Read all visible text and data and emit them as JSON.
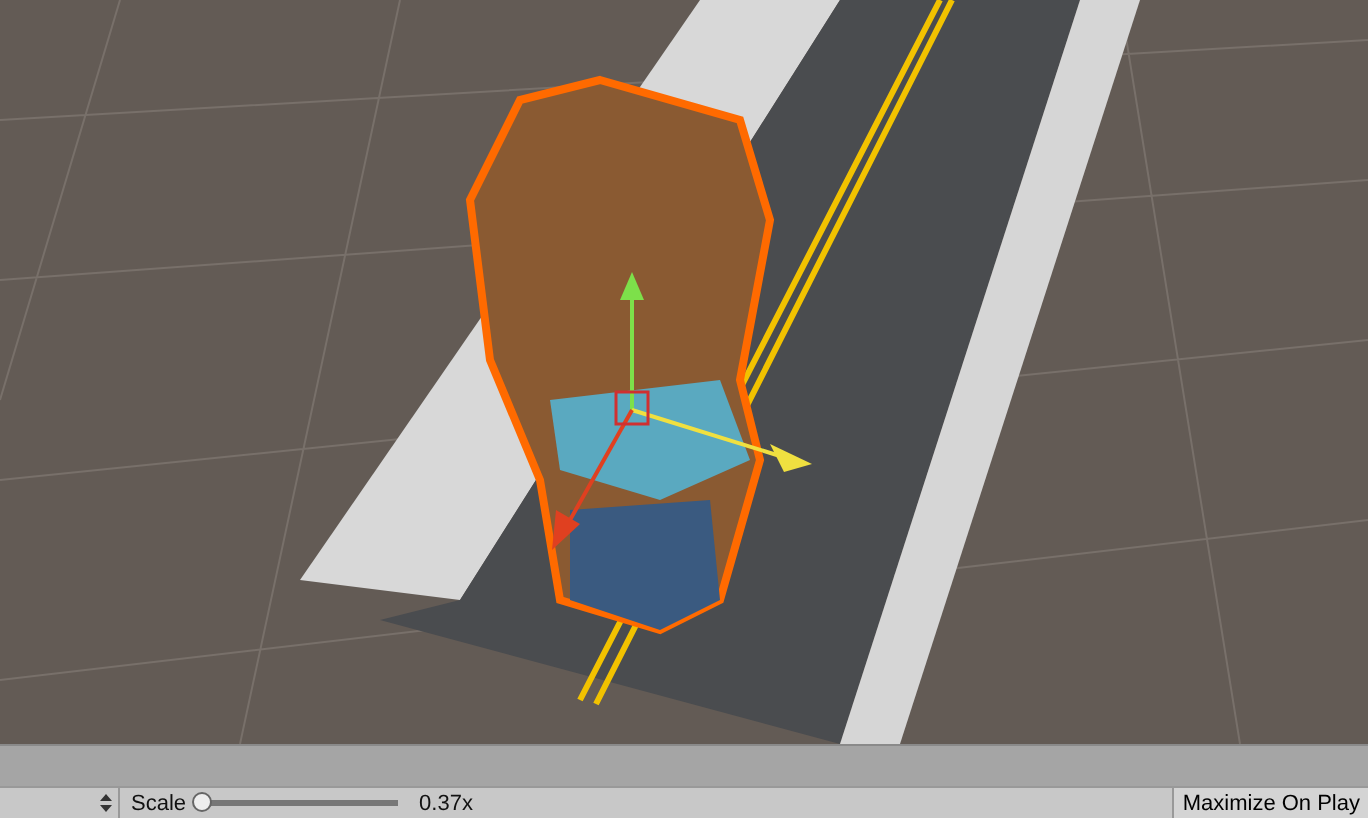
{
  "scene_view": {
    "kind": "scene"
  },
  "game_toolbar": {
    "scale_label": "Scale",
    "scale_slider": {
      "level": 0.02
    },
    "scale_value": "0.37x",
    "maximize_button": "Maximize On Play"
  }
}
